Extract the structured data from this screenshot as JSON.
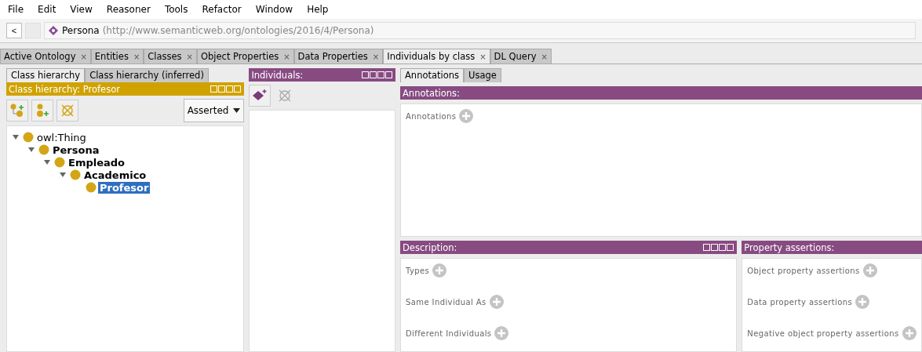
{
  "menu": [
    "File",
    "Edit",
    "View",
    "Reasoner",
    "Tools",
    "Refactor",
    "Window",
    "Help"
  ],
  "nav": {
    "back": "<",
    "entity": "Persona",
    "iri": "(http://www.semanticweb.org/ontologies/2016/4/Persona)"
  },
  "tabs": [
    {
      "label": "Active Ontology",
      "close": "×",
      "selected": false
    },
    {
      "label": "Entities",
      "close": "×",
      "selected": false
    },
    {
      "label": "Classes",
      "close": "×",
      "selected": false
    },
    {
      "label": "Object Properties",
      "close": "×",
      "selected": false
    },
    {
      "label": "Data Properties",
      "close": "×",
      "selected": false
    },
    {
      "label": "Individuals by class",
      "close": "×",
      "selected": true
    },
    {
      "label": "DL Query",
      "close": "×",
      "selected": false
    }
  ],
  "class_panel": {
    "tabs": [
      {
        "label": "Class hierarchy",
        "selected": true
      },
      {
        "label": "Class hierarchy (inferred)",
        "selected": false
      }
    ],
    "header": "Class hierarchy: Profesor",
    "mode": "Asserted",
    "tree": [
      {
        "label": "owl:Thing",
        "bold": false,
        "selected": false,
        "expanded": true,
        "children": [
          {
            "label": "Persona",
            "bold": true,
            "selected": false,
            "expanded": true,
            "children": [
              {
                "label": "Empleado",
                "bold": true,
                "selected": false,
                "expanded": true,
                "children": [
                  {
                    "label": "Academico",
                    "bold": true,
                    "selected": false,
                    "expanded": true,
                    "children": [
                      {
                        "label": "Profesor",
                        "bold": true,
                        "selected": true
                      }
                    ]
                  }
                ]
              }
            ]
          }
        ]
      }
    ]
  },
  "individuals_panel": {
    "header": "Individuals:"
  },
  "right_tabs": [
    {
      "label": "Annotations",
      "selected": true
    },
    {
      "label": "Usage",
      "selected": false
    }
  ],
  "annotations": {
    "header": "Annotations:",
    "items": [
      "Annotations"
    ]
  },
  "description": {
    "header": "Description:",
    "items": [
      "Types",
      "Same Individual As",
      "Different Individuals"
    ]
  },
  "property_assertions": {
    "header": "Property assertions:",
    "items": [
      "Object property assertions",
      "Data property assertions",
      "Negative object property assertions"
    ]
  }
}
